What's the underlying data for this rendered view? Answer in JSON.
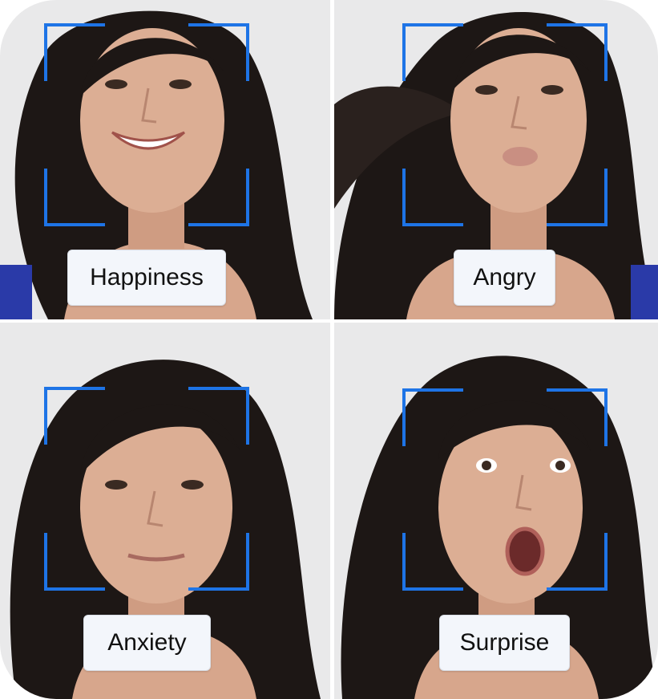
{
  "colors": {
    "frame_bracket": "#1e74e6",
    "label_bg": "#f3f6fb",
    "background_wall": "#e9e9ea",
    "hair": "#1d1715",
    "skin": "#d9a98f"
  },
  "faces": [
    {
      "label": "Happiness",
      "expression": "smile"
    },
    {
      "label": "Angry",
      "expression": "pout"
    },
    {
      "label": "Anxiety",
      "expression": "neutral"
    },
    {
      "label": "Surprise",
      "expression": "open-mouth"
    }
  ]
}
